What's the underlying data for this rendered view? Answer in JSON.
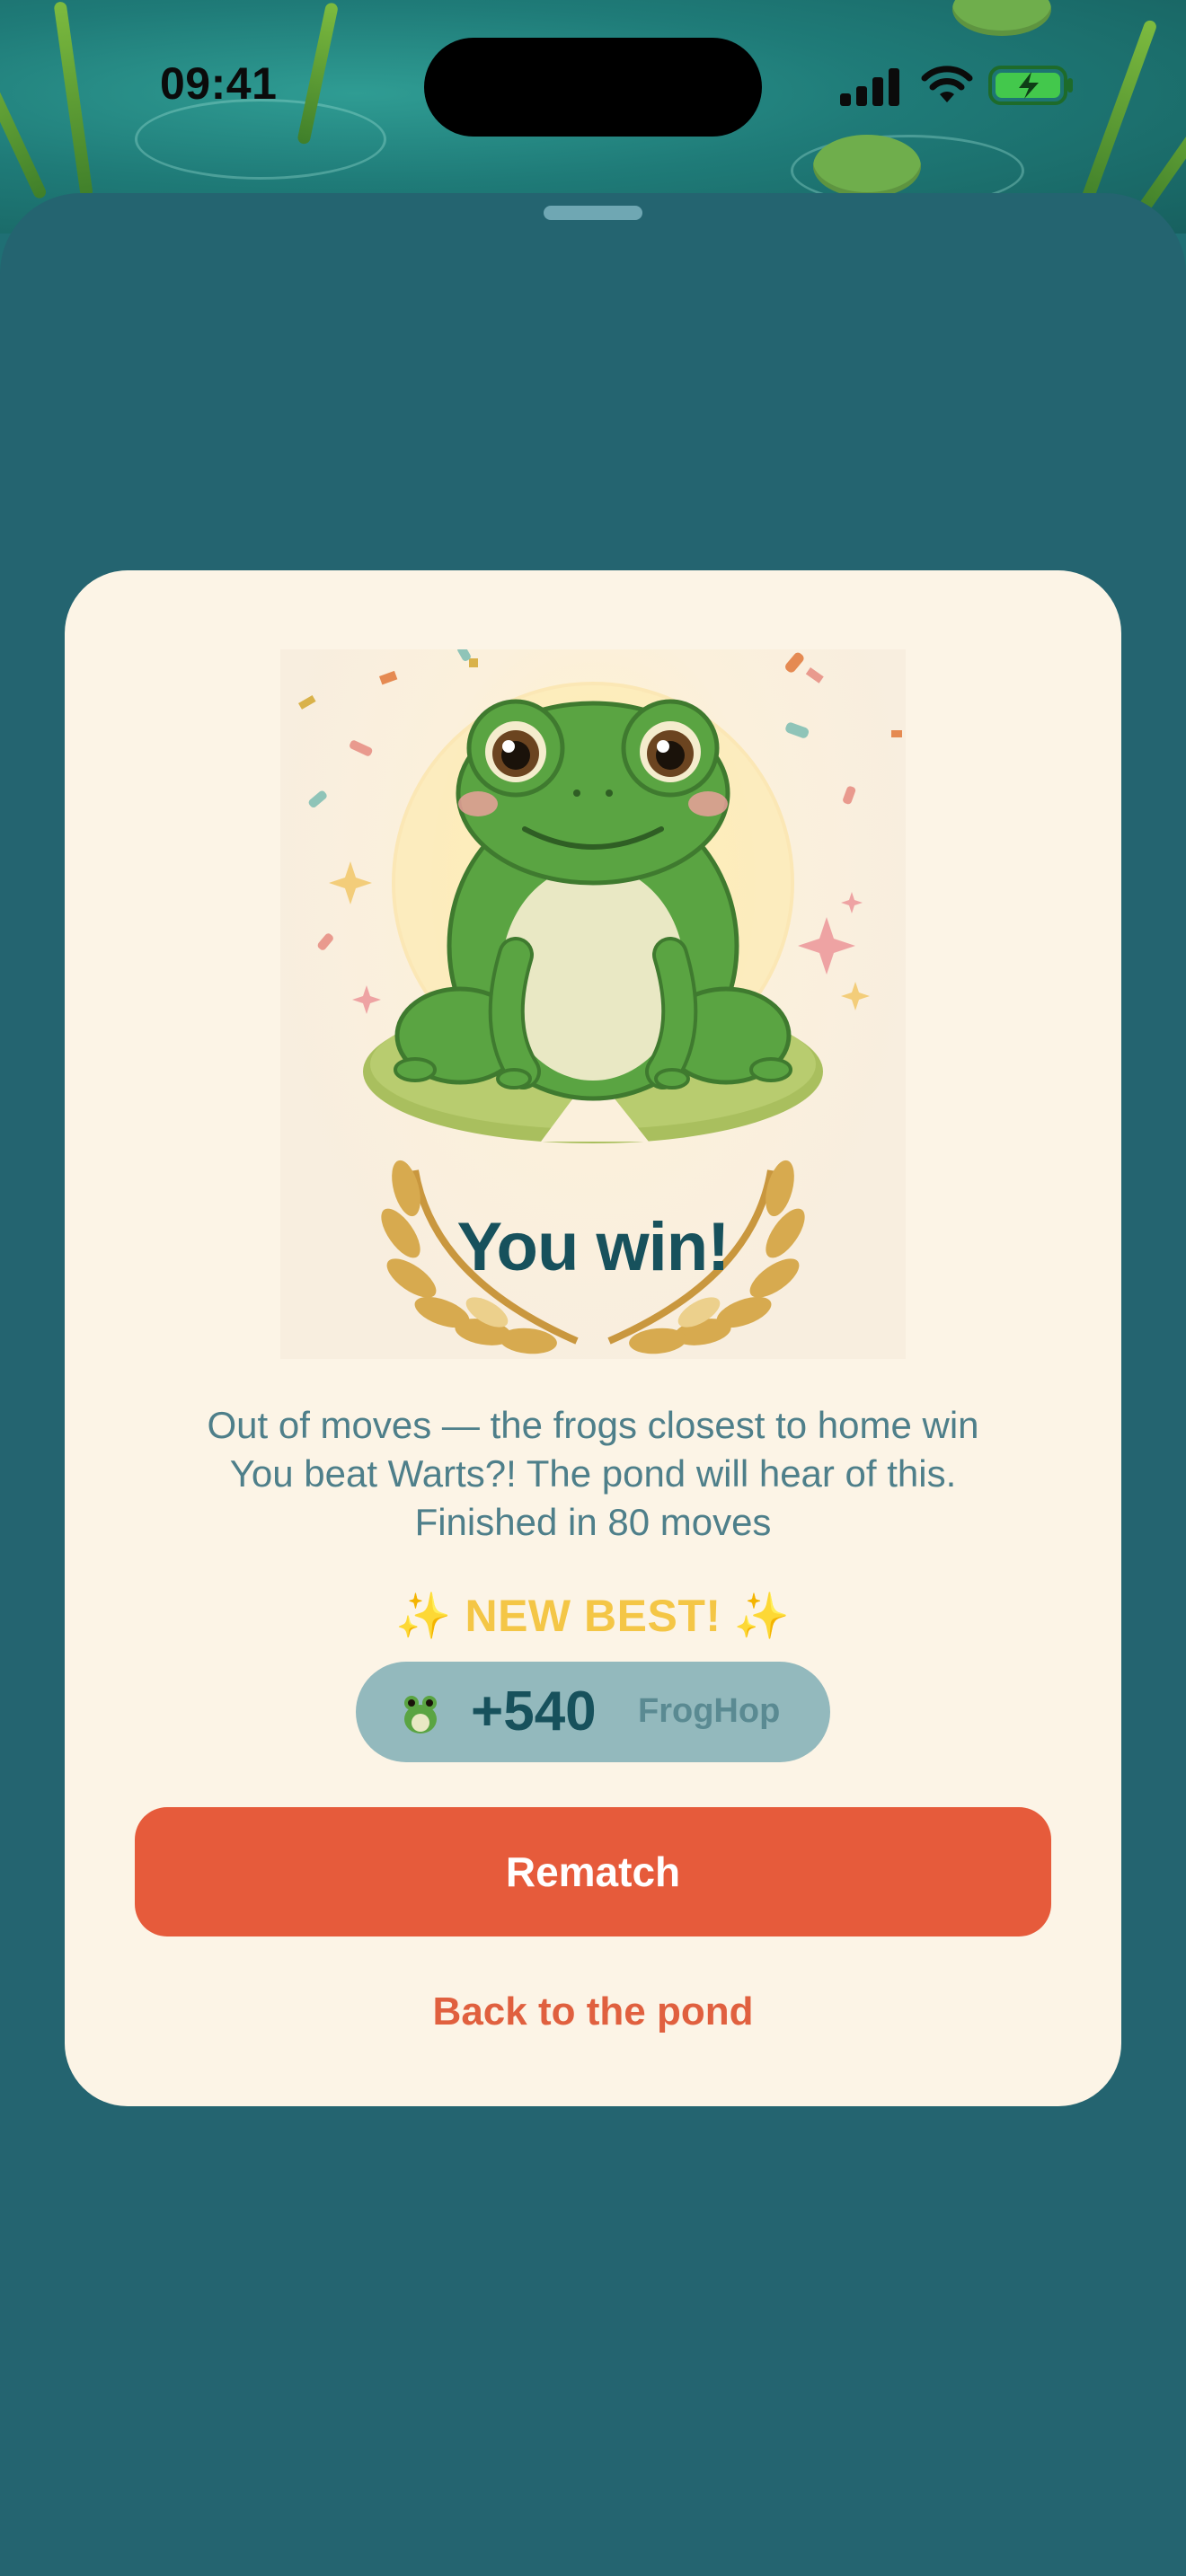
{
  "status_bar": {
    "time": "09:41",
    "icons": [
      "cellular-signal-icon",
      "wifi-icon",
      "battery-charging-icon"
    ]
  },
  "result_card": {
    "hero_image": "frog-on-lily-pad-with-laurel-wreath",
    "title": "You win!",
    "message_lines": [
      "Out of moves — the frogs closest to home win",
      "You beat Warts?! The pond will hear of this.",
      "Finished in 80 moves"
    ],
    "best_badge": "✨ NEW BEST! ✨",
    "score": {
      "icon": "frog-icon",
      "value": "+540",
      "label": "FrogHop"
    },
    "primary_button": "Rematch",
    "secondary_link": "Back to the pond"
  },
  "colors": {
    "sheet_background": "#246470",
    "card_background": "#fcf4e6",
    "primary_accent": "#e65b3b",
    "title_text": "#17515c",
    "body_text": "#4e7f8a",
    "best_badge": "#f4c646",
    "score_pill": "#93b9bd"
  }
}
